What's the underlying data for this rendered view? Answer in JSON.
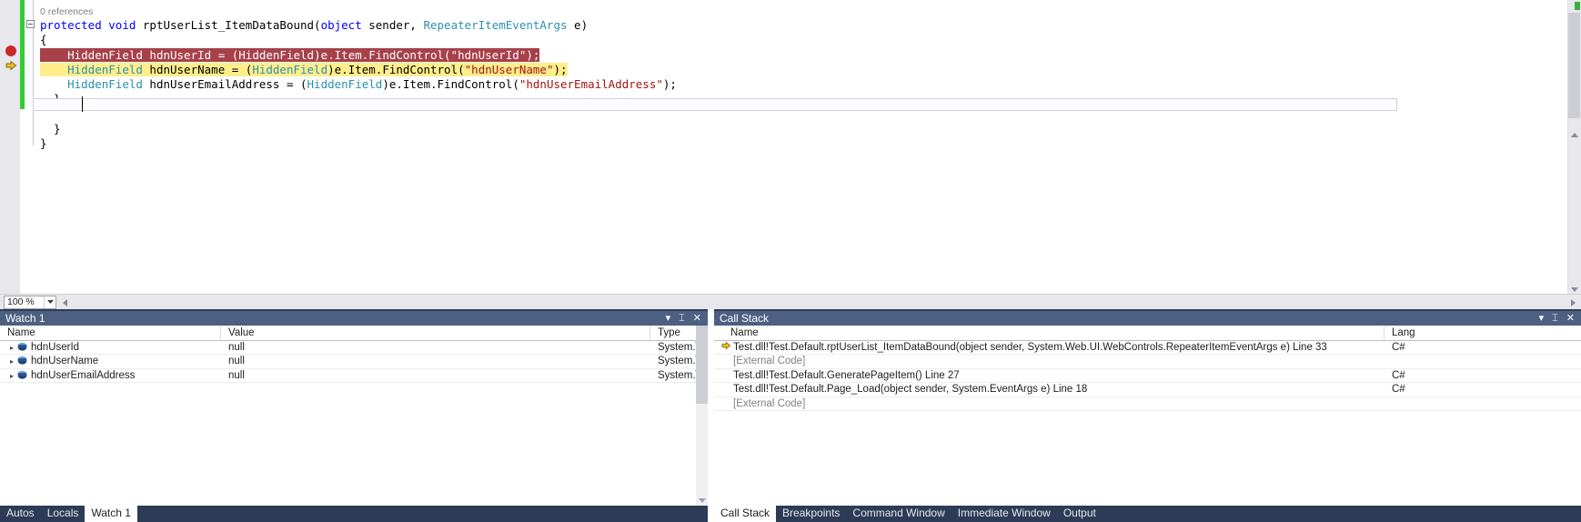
{
  "editor": {
    "codelens": "0 references",
    "zoom_level": "100 %",
    "lines": [
      {
        "id": "codelens",
        "kind": "codelens",
        "text": "0 references"
      },
      {
        "id": "signature",
        "kind": "code",
        "highlight": "none",
        "tokens": [
          {
            "c": "tk-kw",
            "t": "protected "
          },
          {
            "c": "tk-kw",
            "t": "void "
          },
          {
            "c": "tk-plain",
            "t": "rptUserList_ItemDataBound("
          },
          {
            "c": "tk-kw",
            "t": "object"
          },
          {
            "c": "tk-plain",
            "t": " sender, "
          },
          {
            "c": "tk-type",
            "t": "RepeaterItemEventArgs"
          },
          {
            "c": "tk-plain",
            "t": " e)"
          }
        ]
      },
      {
        "id": "open-brace",
        "kind": "code",
        "highlight": "none",
        "tokens": [
          {
            "c": "tk-plain",
            "t": "{"
          }
        ]
      },
      {
        "id": "decl-userid",
        "kind": "code",
        "highlight": "breakpoint",
        "tokens": [
          {
            "c": "tk-plain",
            "t": "    "
          },
          {
            "c": "tk-type",
            "t": "HiddenField"
          },
          {
            "c": "tk-plain",
            "t": " hdnUserId = ("
          },
          {
            "c": "tk-type",
            "t": "HiddenField"
          },
          {
            "c": "tk-plain",
            "t": ")e.Item.FindControl("
          },
          {
            "c": "tk-str",
            "t": "\"hdnUserId\""
          },
          {
            "c": "tk-plain",
            "t": ");"
          }
        ]
      },
      {
        "id": "decl-username",
        "kind": "code",
        "highlight": "current",
        "tokens": [
          {
            "c": "tk-plain",
            "t": "    "
          },
          {
            "c": "tk-type",
            "t": "HiddenField"
          },
          {
            "c": "tk-plain",
            "t": " hdnUserName = ("
          },
          {
            "c": "tk-type",
            "t": "HiddenField"
          },
          {
            "c": "tk-plain",
            "t": ")e.Item.FindControl("
          },
          {
            "c": "tk-str",
            "t": "\"hdnUserName\""
          },
          {
            "c": "tk-plain",
            "t": ");"
          }
        ]
      },
      {
        "id": "decl-email",
        "kind": "code",
        "highlight": "none",
        "tokens": [
          {
            "c": "tk-plain",
            "t": "    "
          },
          {
            "c": "tk-type",
            "t": "HiddenField"
          },
          {
            "c": "tk-plain",
            "t": " hdnUserEmailAddress = ("
          },
          {
            "c": "tk-type",
            "t": "HiddenField"
          },
          {
            "c": "tk-plain",
            "t": ")e.Item.FindControl("
          },
          {
            "c": "tk-str",
            "t": "\"hdnUserEmailAddress\""
          },
          {
            "c": "tk-plain",
            "t": ");"
          }
        ]
      },
      {
        "id": "close-brace-method",
        "kind": "code",
        "highlight": "none",
        "tokens": [
          {
            "c": "tk-plain",
            "t": "  }"
          }
        ]
      },
      {
        "id": "caret-blank",
        "kind": "blank",
        "tokens": []
      },
      {
        "id": "close-brace-class",
        "kind": "code",
        "highlight": "none",
        "tokens": [
          {
            "c": "tk-plain",
            "t": "  }"
          }
        ]
      },
      {
        "id": "close-brace-ns",
        "kind": "code",
        "highlight": "none",
        "tokens": [
          {
            "c": "tk-plain",
            "t": "}"
          }
        ]
      }
    ]
  },
  "watch": {
    "title": "Watch 1",
    "columns": [
      "Name",
      "Value",
      "Type"
    ],
    "rows": [
      {
        "name": "hdnUserId",
        "value": "null",
        "type": "System.\\"
      },
      {
        "name": "hdnUserName",
        "value": "null",
        "type": "System.\\"
      },
      {
        "name": "hdnUserEmailAddress",
        "value": "null",
        "type": "System.\\"
      }
    ],
    "tabs": [
      {
        "label": "Autos",
        "active": false
      },
      {
        "label": "Locals",
        "active": false
      },
      {
        "label": "Watch 1",
        "active": true
      }
    ],
    "buttons": {
      "dropdown": "▾",
      "pin": "⌶",
      "close": "✕"
    }
  },
  "callstack": {
    "title": "Call Stack",
    "columns": [
      "Name",
      "Lang"
    ],
    "rows": [
      {
        "name": "Test.dll!Test.Default.rptUserList_ItemDataBound(object sender, System.Web.UI.WebControls.RepeaterItemEventArgs e) Line 33",
        "lang": "C#",
        "current": true,
        "external": false
      },
      {
        "name": "[External Code]",
        "lang": "",
        "current": false,
        "external": true
      },
      {
        "name": "Test.dll!Test.Default.GeneratePageItem() Line 27",
        "lang": "C#",
        "current": false,
        "external": false
      },
      {
        "name": "Test.dll!Test.Default.Page_Load(object sender, System.EventArgs e) Line 18",
        "lang": "C#",
        "current": false,
        "external": false
      },
      {
        "name": "[External Code]",
        "lang": "",
        "current": false,
        "external": true
      }
    ],
    "tabs": [
      {
        "label": "Call Stack",
        "active": true
      },
      {
        "label": "Breakpoints",
        "active": false
      },
      {
        "label": "Command Window",
        "active": false
      },
      {
        "label": "Immediate Window",
        "active": false
      },
      {
        "label": "Output",
        "active": false
      }
    ],
    "buttons": {
      "dropdown": "▾",
      "pin": "⌶",
      "close": "✕"
    }
  },
  "colors": {
    "panel_title_bg": "#4d6082",
    "tabstrip_bg": "#2d3c56",
    "breakpoint_red": "#c9292b",
    "breakpoint_line_bg": "#a6414a",
    "current_line_bg": "#ffee8c",
    "changebar_green": "#33cc33",
    "current_arrow_yellow": "#e8c020"
  }
}
